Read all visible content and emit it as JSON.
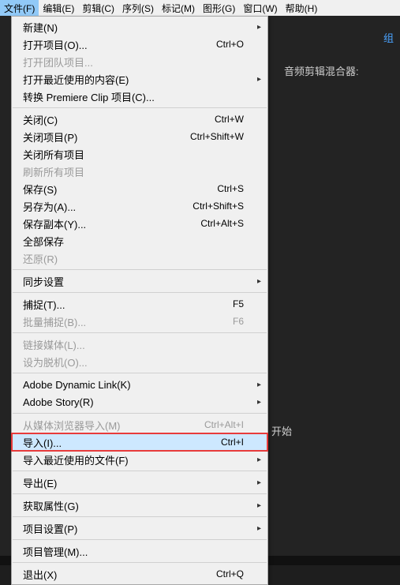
{
  "menubar": {
    "items": [
      {
        "label": "文件(F)",
        "active": true
      },
      {
        "label": "编辑(E)"
      },
      {
        "label": "剪辑(C)"
      },
      {
        "label": "序列(S)"
      },
      {
        "label": "标记(M)"
      },
      {
        "label": "图形(G)"
      },
      {
        "label": "窗口(W)"
      },
      {
        "label": "帮助(H)"
      }
    ]
  },
  "right_panel": {
    "tab": "组",
    "label_top": "音频剪辑混合器:",
    "label_mid": "开始"
  },
  "file_menu": [
    {
      "type": "item",
      "label": "新建(N)",
      "sub": true
    },
    {
      "type": "item",
      "label": "打开项目(O)...",
      "shortcut": "Ctrl+O"
    },
    {
      "type": "item",
      "label": "打开团队项目...",
      "disabled": true
    },
    {
      "type": "item",
      "label": "打开最近使用的内容(E)",
      "sub": true
    },
    {
      "type": "item",
      "label": "转换 Premiere Clip 项目(C)..."
    },
    {
      "type": "sep"
    },
    {
      "type": "item",
      "label": "关闭(C)",
      "shortcut": "Ctrl+W"
    },
    {
      "type": "item",
      "label": "关闭项目(P)",
      "shortcut": "Ctrl+Shift+W"
    },
    {
      "type": "item",
      "label": "关闭所有项目"
    },
    {
      "type": "item",
      "label": "刷新所有项目",
      "disabled": true
    },
    {
      "type": "item",
      "label": "保存(S)",
      "shortcut": "Ctrl+S"
    },
    {
      "type": "item",
      "label": "另存为(A)...",
      "shortcut": "Ctrl+Shift+S"
    },
    {
      "type": "item",
      "label": "保存副本(Y)...",
      "shortcut": "Ctrl+Alt+S"
    },
    {
      "type": "item",
      "label": "全部保存"
    },
    {
      "type": "item",
      "label": "还原(R)",
      "disabled": true
    },
    {
      "type": "sep"
    },
    {
      "type": "item",
      "label": "同步设置",
      "sub": true
    },
    {
      "type": "sep"
    },
    {
      "type": "item",
      "label": "捕捉(T)...",
      "shortcut": "F5"
    },
    {
      "type": "item",
      "label": "批量捕捉(B)...",
      "shortcut": "F6",
      "disabled": true
    },
    {
      "type": "sep"
    },
    {
      "type": "item",
      "label": "链接媒体(L)...",
      "disabled": true
    },
    {
      "type": "item",
      "label": "设为脱机(O)...",
      "disabled": true
    },
    {
      "type": "sep"
    },
    {
      "type": "item",
      "label": "Adobe Dynamic Link(K)",
      "sub": true
    },
    {
      "type": "item",
      "label": "Adobe Story(R)",
      "sub": true
    },
    {
      "type": "sep"
    },
    {
      "type": "item",
      "label": "从媒体浏览器导入(M)",
      "shortcut": "Ctrl+Alt+I",
      "disabled": true
    },
    {
      "type": "item",
      "label": "导入(I)...",
      "shortcut": "Ctrl+I",
      "highlight": true
    },
    {
      "type": "item",
      "label": "导入最近使用的文件(F)",
      "sub": true
    },
    {
      "type": "sep"
    },
    {
      "type": "item",
      "label": "导出(E)",
      "sub": true
    },
    {
      "type": "sep"
    },
    {
      "type": "item",
      "label": "获取属性(G)",
      "sub": true
    },
    {
      "type": "sep"
    },
    {
      "type": "item",
      "label": "项目设置(P)",
      "sub": true
    },
    {
      "type": "sep"
    },
    {
      "type": "item",
      "label": "项目管理(M)..."
    },
    {
      "type": "sep"
    },
    {
      "type": "item",
      "label": "退出(X)",
      "shortcut": "Ctrl+Q"
    }
  ]
}
